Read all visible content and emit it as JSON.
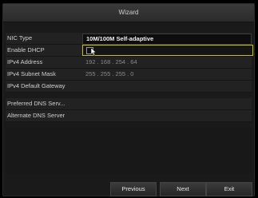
{
  "window": {
    "title": "Wizard"
  },
  "fields": {
    "nic_type": {
      "label": "NIC Type",
      "value": "10M/100M Self-adaptive"
    },
    "enable_dhcp": {
      "label": "Enable DHCP",
      "checked": false
    },
    "ipv4_address": {
      "label": "IPv4 Address",
      "value": "192 . 168 . 254 . 64"
    },
    "ipv4_subnet_mask": {
      "label": "IPv4 Subnet Mask",
      "value": "255 . 255 . 255 . 0"
    },
    "ipv4_default_gateway": {
      "label": "IPv4 Default Gateway",
      "value": ""
    },
    "preferred_dns": {
      "label": "Preferred DNS Serv...",
      "value": ""
    },
    "alternate_dns": {
      "label": "Alternate DNS Server",
      "value": ""
    }
  },
  "buttons": {
    "previous": "Previous",
    "next": "Next",
    "exit": "Exit"
  },
  "colors": {
    "focus_outline": "#c8c000",
    "panel_bg": "#1a1a1a",
    "text": "#cfcfcf"
  }
}
